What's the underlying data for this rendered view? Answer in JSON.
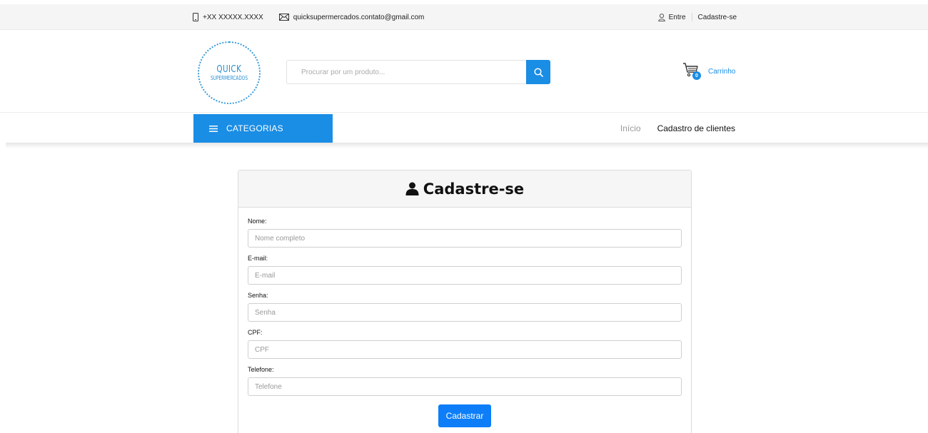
{
  "topbar": {
    "phone": "+XX XXXXX.XXXX",
    "email": "quicksupermercados.contato@gmail.com",
    "login": "Entre",
    "signup": "Cadastre-se"
  },
  "header": {
    "logo_line1": "QUICK",
    "logo_line2": "SUPERMERCADOS",
    "search_placeholder": "Procurar por um produto...",
    "cart_label": "Carrinho",
    "cart_count": "0"
  },
  "nav": {
    "categories_label": "CATEGORIAS",
    "breadcrumb_home": "Início",
    "breadcrumb_current": "Cadastro de clientes"
  },
  "form": {
    "title": "Cadastre-se",
    "fields": [
      {
        "label": "Nome:",
        "placeholder": "Nome completo"
      },
      {
        "label": "E-mail:",
        "placeholder": "E-mail"
      },
      {
        "label": "Senha:",
        "placeholder": "Senha"
      },
      {
        "label": "CPF:",
        "placeholder": "CPF"
      },
      {
        "label": "Telefone:",
        "placeholder": "Telefone"
      }
    ],
    "submit_label": "Cadastrar"
  },
  "colors": {
    "accent": "#1a8de5",
    "button": "#0d7ef7"
  },
  "icons": {
    "phone": "phone-icon",
    "email": "envelope-icon",
    "user": "user-icon",
    "search": "search-icon",
    "cart": "cart-icon",
    "menu": "menu-icon"
  }
}
